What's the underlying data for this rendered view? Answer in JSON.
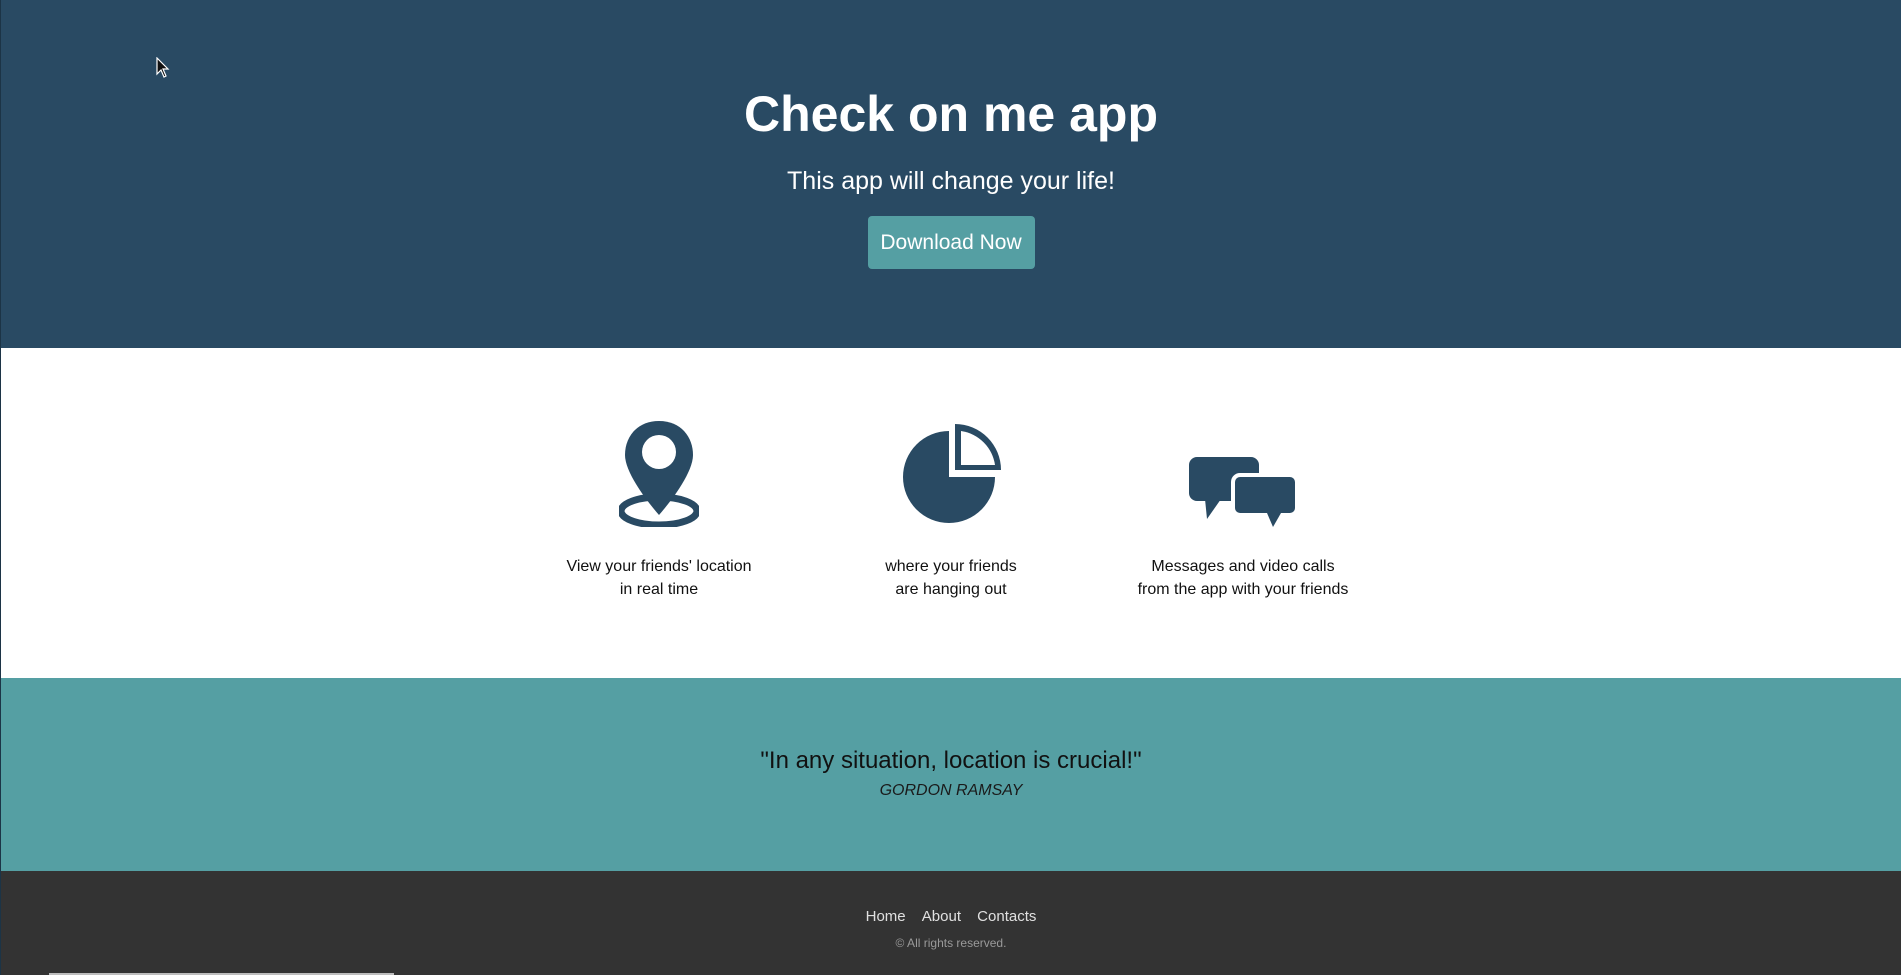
{
  "hero": {
    "title": "Check on me app",
    "subtitle": "This app will change your life!",
    "download_label": "Download Now"
  },
  "features": [
    {
      "icon": "map-pin-icon",
      "line1": "View your friends' location",
      "line2": "in real time"
    },
    {
      "icon": "pie-chart-icon",
      "line1": "where your friends",
      "line2": "are hanging out"
    },
    {
      "icon": "chat-bubbles-icon",
      "line1": "Messages and video calls",
      "line2": "from the app with your friends"
    }
  ],
  "quote": {
    "text": "\"In any situation, location is crucial!\"",
    "author": "GORDON RAMSAY"
  },
  "footer": {
    "nav": [
      "Home",
      "About",
      "Contacts"
    ],
    "copyright": "© All rights reserved."
  },
  "colors": {
    "hero_bg": "#294a63",
    "accent": "#559fa3",
    "icon": "#294a63",
    "footer_bg": "#333333"
  }
}
